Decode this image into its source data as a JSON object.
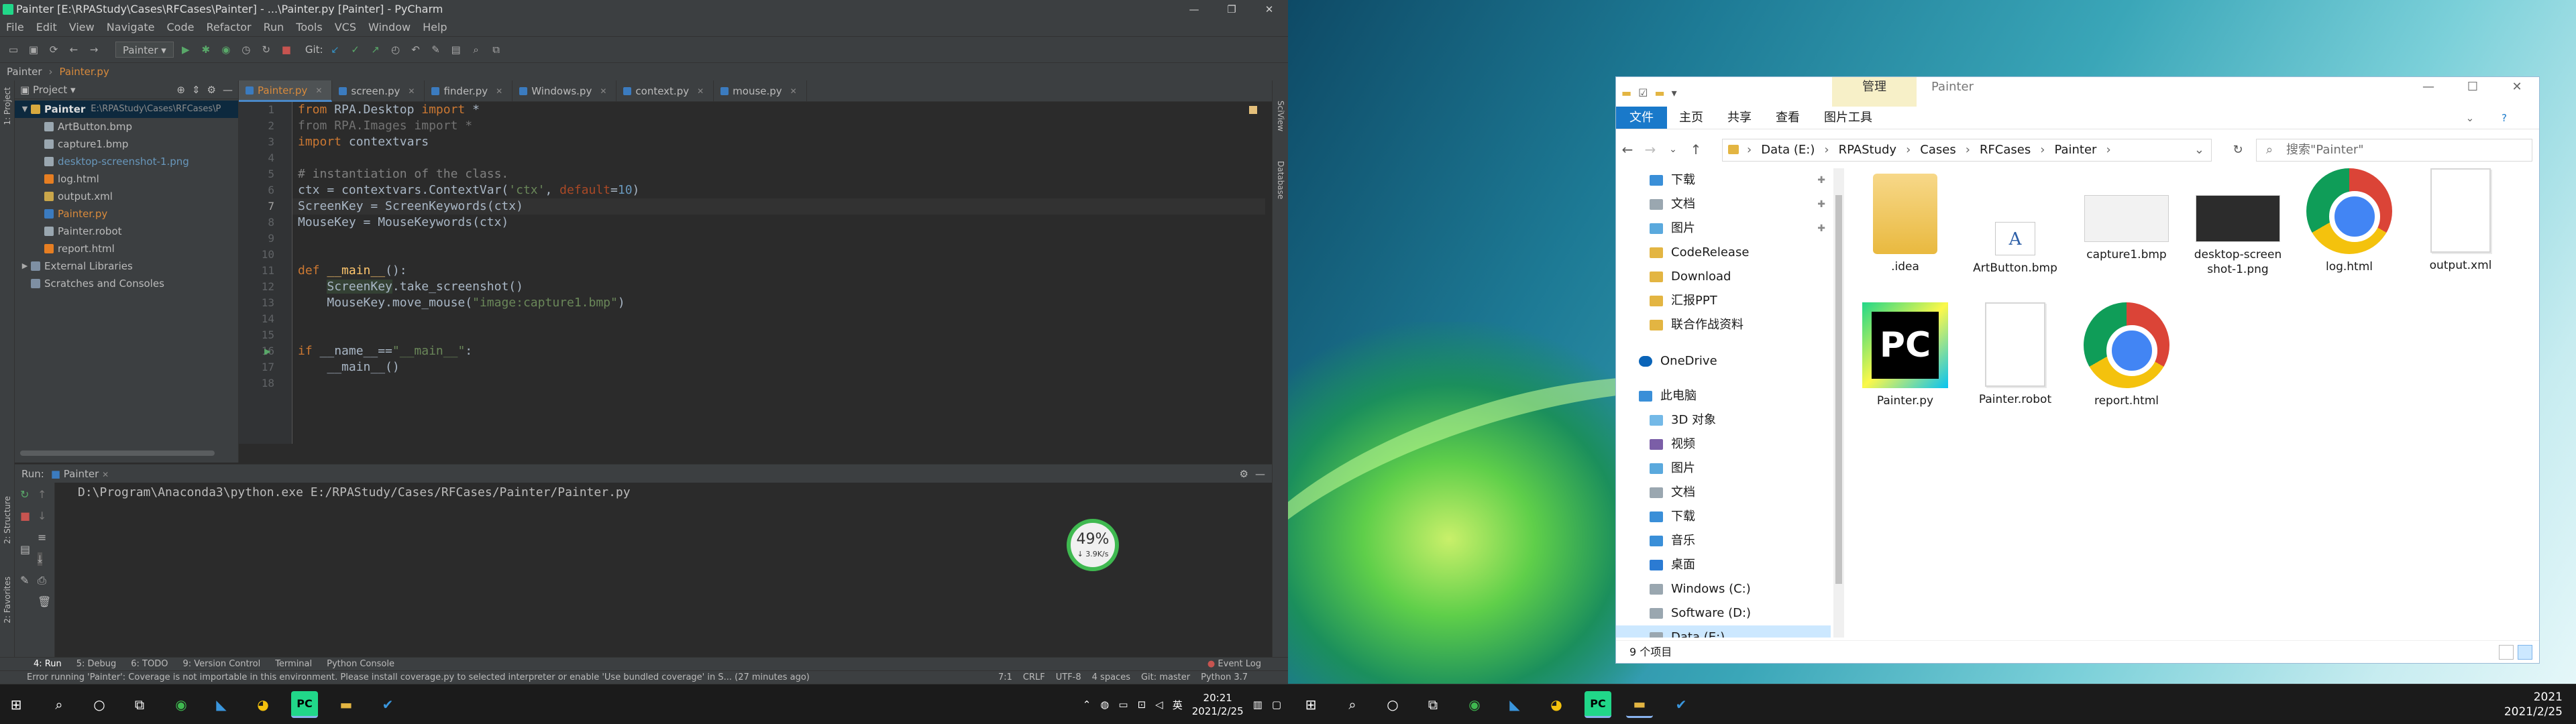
{
  "pycharm": {
    "title": "Painter [E:\\RPAStudy\\Cases\\RFCases\\Painter] - ...\\Painter.py [Painter] - PyCharm",
    "menu": [
      "File",
      "Edit",
      "View",
      "Navigate",
      "Code",
      "Refactor",
      "Run",
      "Tools",
      "VCS",
      "Window",
      "Help"
    ],
    "run_config": "Painter",
    "git_label": "Git:",
    "breadcrumb": [
      "Painter",
      "Painter.py"
    ],
    "project_panel": {
      "title": "Project",
      "root": "Painter",
      "root_path": "E:\\RPAStudy\\Cases\\RFCases\\P",
      "items": [
        {
          "name": "ArtButton.bmp",
          "type": "file"
        },
        {
          "name": "capture1.bmp",
          "type": "file"
        },
        {
          "name": "desktop-screenshot-1.png",
          "type": "file"
        },
        {
          "name": "log.html",
          "type": "html"
        },
        {
          "name": "output.xml",
          "type": "xml"
        },
        {
          "name": "Painter.py",
          "type": "py"
        },
        {
          "name": "Painter.robot",
          "type": "file"
        },
        {
          "name": "report.html",
          "type": "html"
        }
      ],
      "external": "External Libraries",
      "scratches": "Scratches and Consoles"
    },
    "tabs": [
      "Painter.py",
      "screen.py",
      "finder.py",
      "Windows.py",
      "context.py",
      "mouse.py"
    ],
    "line_numbers": [
      "1",
      "2",
      "3",
      "4",
      "5",
      "6",
      "7",
      "8",
      "9",
      "10",
      "11",
      "12",
      "13",
      "14",
      "15",
      "16",
      "17",
      "18"
    ],
    "code": {
      "l1": {
        "kw": "from",
        "mod": " RPA.Desktop ",
        "kw2": "import",
        "rest": " *"
      },
      "l2": {
        "kw": "from",
        "mod": " RPA.Images ",
        "kw2": "import",
        "rest": " *"
      },
      "l3": {
        "kw": "import",
        "rest": " contextvars"
      },
      "l5": "# instantiation of the class.",
      "l6": {
        "a": "ctx = contextvars.ContextVar(",
        "s": "'ctx'",
        "c": ", ",
        "k": "default",
        "d": "=",
        "n": "10",
        ")": ")"
      },
      "l7": "ScreenKey = ScreenKeywords(ctx)",
      "l8": "MouseKey = MouseKeywords(ctx)",
      "l11": {
        "kw": "def",
        "fn": " __main__",
        "rest": "():"
      },
      "l12": {
        "hl": "ScreenKey",
        "rest": ".take_screenshot()"
      },
      "l13": {
        "a": "MouseKey.move_mouse(",
        "s": "\"image:capture1.bmp\"",
        "b": ")"
      },
      "l16": {
        "kw": "if",
        "a": " __name__==",
        "s": "\"__main__\"",
        "b": ":"
      },
      "l17": "__main__()"
    },
    "run": {
      "label": "Run:",
      "config": "Painter",
      "output": "D:\\Program\\Anaconda3\\python.exe E:/RPAStudy/Cases/RFCases/Painter/Painter.py"
    },
    "net_widget": {
      "percent": "49",
      "unit": "%",
      "speed": "↓ 3.9K/s"
    },
    "bottom_tools": [
      "4: Run",
      "5: Debug",
      "6: TODO",
      "9: Version Control",
      "Terminal",
      "Python Console"
    ],
    "event_log": "Event Log",
    "status_message": "Error running 'Painter': Coverage is not importable in this environment. Please install coverage.py to selected interpreter or enable 'Use bundled coverage' in S... (27 minutes ago)",
    "status_right": [
      "7:1",
      "CRLF",
      "UTF-8",
      "4 spaces",
      "Git: master",
      "Python 3.7"
    ],
    "stripes": {
      "left_top": "1: Project",
      "left_mid": "2: Structure",
      "left_bottom": "2: Favorites",
      "right_top": "SciView",
      "right_mid": "Database"
    }
  },
  "taskbar_left": {
    "time": "20:21",
    "date": "2021/2/25",
    "ime": "英"
  },
  "explorer": {
    "context_tab": "管理",
    "folder_name": "Painter",
    "ribbon": [
      "文件",
      "主页",
      "共享",
      "查看",
      "图片工具"
    ],
    "address": [
      "Data (E:)",
      "RPAStudy",
      "Cases",
      "RFCases",
      "Painter"
    ],
    "search_placeholder": "搜索\"Painter\"",
    "nav": [
      {
        "label": "下载",
        "pinned": true
      },
      {
        "label": "文档",
        "pinned": true
      },
      {
        "label": "图片",
        "pinned": true
      },
      {
        "label": "CodeRelease"
      },
      {
        "label": "Download"
      },
      {
        "label": "汇报PPT"
      },
      {
        "label": "联合作战资料"
      },
      {
        "label": "OneDrive"
      },
      {
        "label": "此电脑"
      },
      {
        "label": "3D 对象"
      },
      {
        "label": "视频"
      },
      {
        "label": "图片"
      },
      {
        "label": "文档"
      },
      {
        "label": "下载"
      },
      {
        "label": "音乐"
      },
      {
        "label": "桌面"
      },
      {
        "label": "Windows (C:)"
      },
      {
        "label": "Software (D:)"
      },
      {
        "label": "Data (E:)"
      }
    ],
    "items": [
      {
        "label": ".idea",
        "icon": "folder-icon"
      },
      {
        "label": "ArtButton.bmp",
        "icon": "bmp-icon"
      },
      {
        "label": "capture1.bmp",
        "icon": "image-icon"
      },
      {
        "label": "desktop-screenshot-1.png",
        "label_l1": "desktop-screen",
        "label_l2": "shot-1.png",
        "icon": "image-icon"
      },
      {
        "label": "log.html",
        "icon": "chrome-icon"
      },
      {
        "label": "output.xml",
        "icon": "document-icon"
      },
      {
        "label": "Painter.py",
        "icon": "pycharm-icon"
      },
      {
        "label": "Painter.robot",
        "icon": "document-icon"
      },
      {
        "label": "report.html",
        "icon": "chrome-icon"
      }
    ],
    "status": "9 个项目"
  },
  "taskbar_right": {
    "time": "2021",
    "date": "2021/2/25"
  }
}
